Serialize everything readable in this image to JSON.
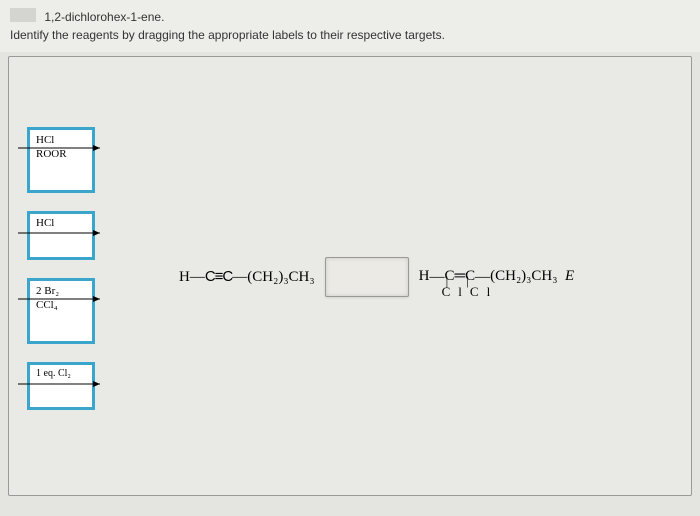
{
  "header": {
    "compound": "1,2-dichlorohex-1-ene.",
    "instruction": "Identify the reagents by dragging the appropriate labels to their respective targets."
  },
  "reagents": [
    {
      "top": "HCl",
      "bottom": "ROOR"
    },
    {
      "top": "HCl",
      "bottom": ""
    },
    {
      "top": "2 Br₂",
      "bottom": "CCl₄"
    },
    {
      "top": "1 eq. Cl₂",
      "bottom": ""
    }
  ],
  "reaction": {
    "reactant": {
      "h": "H",
      "triple": "C≡C",
      "chain": "(CH₂)₃CH₃"
    },
    "product": {
      "h": "H",
      "dbl": "C═C",
      "chain": "(CH₂)₃CH₃",
      "stereo": "E",
      "substituent": "Cl",
      "substituent2": "Cl"
    }
  }
}
